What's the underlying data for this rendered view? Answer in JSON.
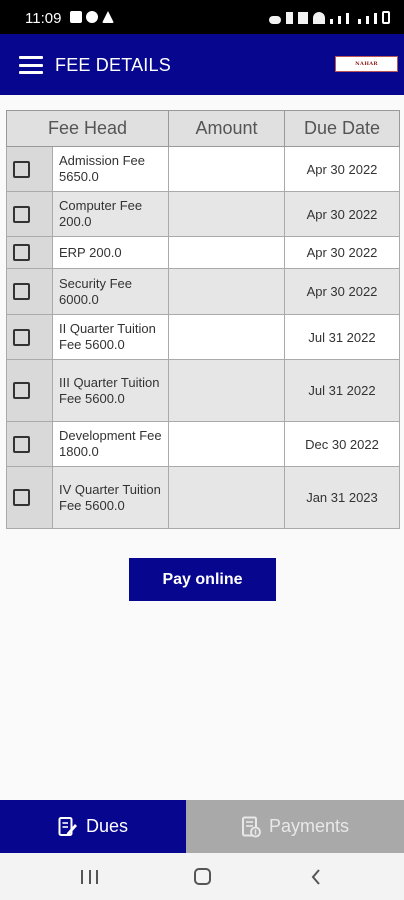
{
  "status_bar": {
    "time": "11:09"
  },
  "app_bar": {
    "title": "FEE DETAILS",
    "logo_text": "NAHAR"
  },
  "table": {
    "headers": {
      "fee_head": "Fee Head",
      "amount": "Amount",
      "due_date": "Due Date"
    },
    "rows": [
      {
        "fee_head": "Admission Fee 5650.0",
        "amount": "",
        "due_date": "Apr 30 2022"
      },
      {
        "fee_head": "Computer Fee 200.0",
        "amount": "",
        "due_date": "Apr 30 2022"
      },
      {
        "fee_head": "ERP 200.0",
        "amount": "",
        "due_date": "Apr 30 2022"
      },
      {
        "fee_head": "Security Fee 6000.0",
        "amount": "",
        "due_date": "Apr 30 2022"
      },
      {
        "fee_head": "II Quarter Tuition Fee 5600.0",
        "amount": "",
        "due_date": "Jul 31 2022"
      },
      {
        "fee_head": "III Quarter Tuition Fee 5600.0",
        "amount": "",
        "due_date": "Jul 31 2022"
      },
      {
        "fee_head": "Development Fee 1800.0",
        "amount": "",
        "due_date": "Dec 30 2022"
      },
      {
        "fee_head": "IV Quarter Tuition Fee 5600.0",
        "amount": "",
        "due_date": "Jan 31 2023"
      }
    ]
  },
  "pay_button": {
    "label": "Pay online"
  },
  "bottom_tabs": {
    "dues": {
      "label": "Dues",
      "icon": "edit-document-icon",
      "active": true
    },
    "payments": {
      "label": "Payments",
      "icon": "receipt-icon",
      "active": false
    }
  },
  "colors": {
    "primary": "#06068f",
    "inactive_tab": "#a9a9a9"
  }
}
